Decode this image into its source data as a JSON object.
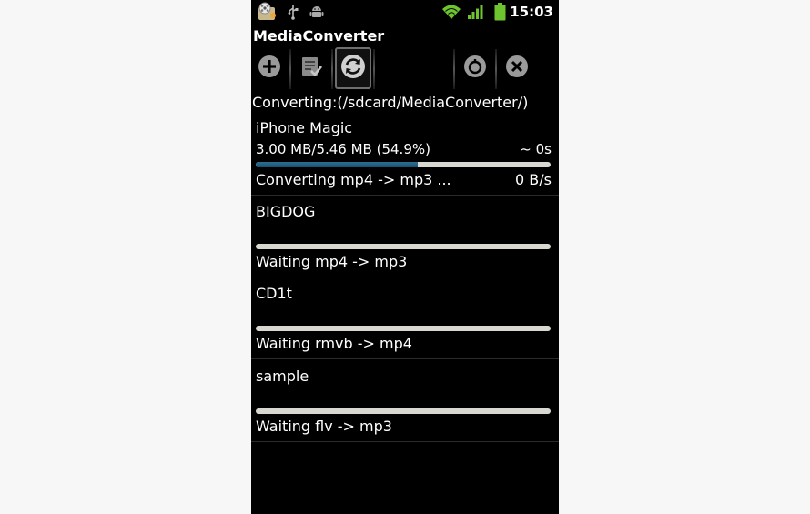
{
  "status_bar": {
    "time": "15:03",
    "icons": [
      "media-converter-app-icon",
      "usb-icon",
      "android-debug-icon",
      "wifi-icon",
      "signal-icon",
      "battery-icon"
    ]
  },
  "app": {
    "title": "MediaConverter"
  },
  "toolbar": {
    "buttons": [
      "add-icon",
      "task-list-icon",
      "convert-refresh-icon",
      "timer-icon",
      "cancel-icon"
    ],
    "selected": "convert-refresh-icon",
    "accent_color": "#2c6f96"
  },
  "converting_path": "Converting:(/sdcard/MediaConverter/)",
  "tasks": [
    {
      "name": "iPhone Magic",
      "size": "3.00 MB/5.46 MB (54.9%)",
      "eta": "~ 0s",
      "progress": 0.549,
      "status": "Converting mp4 -> mp3 ...",
      "speed": "0 B/s"
    },
    {
      "name": "BIGDOG",
      "progress": 0,
      "status": "Waiting mp4 -> mp3"
    },
    {
      "name": "CD1t",
      "progress": 0,
      "status": "Waiting rmvb -> mp4"
    },
    {
      "name": "sample",
      "progress": 0,
      "status": "Waiting flv -> mp3"
    }
  ]
}
